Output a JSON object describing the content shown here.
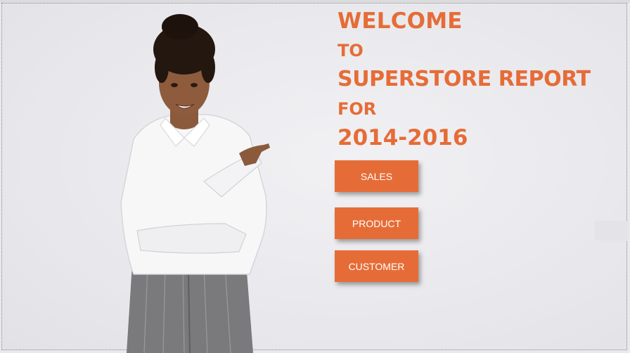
{
  "hero": {
    "line1": "WELCOME",
    "line2": "TO",
    "line3": "SUPERSTORE REPORT",
    "line4": "FOR",
    "line5": "2014-2016"
  },
  "nav": {
    "sales_label": "SALES",
    "product_label": "PRODUCT",
    "customer_label": "CUSTOMER"
  },
  "colors": {
    "accent": "#e66c37",
    "background": "#e9e9ed"
  },
  "image": {
    "subject": "woman-pointing-illustration"
  }
}
